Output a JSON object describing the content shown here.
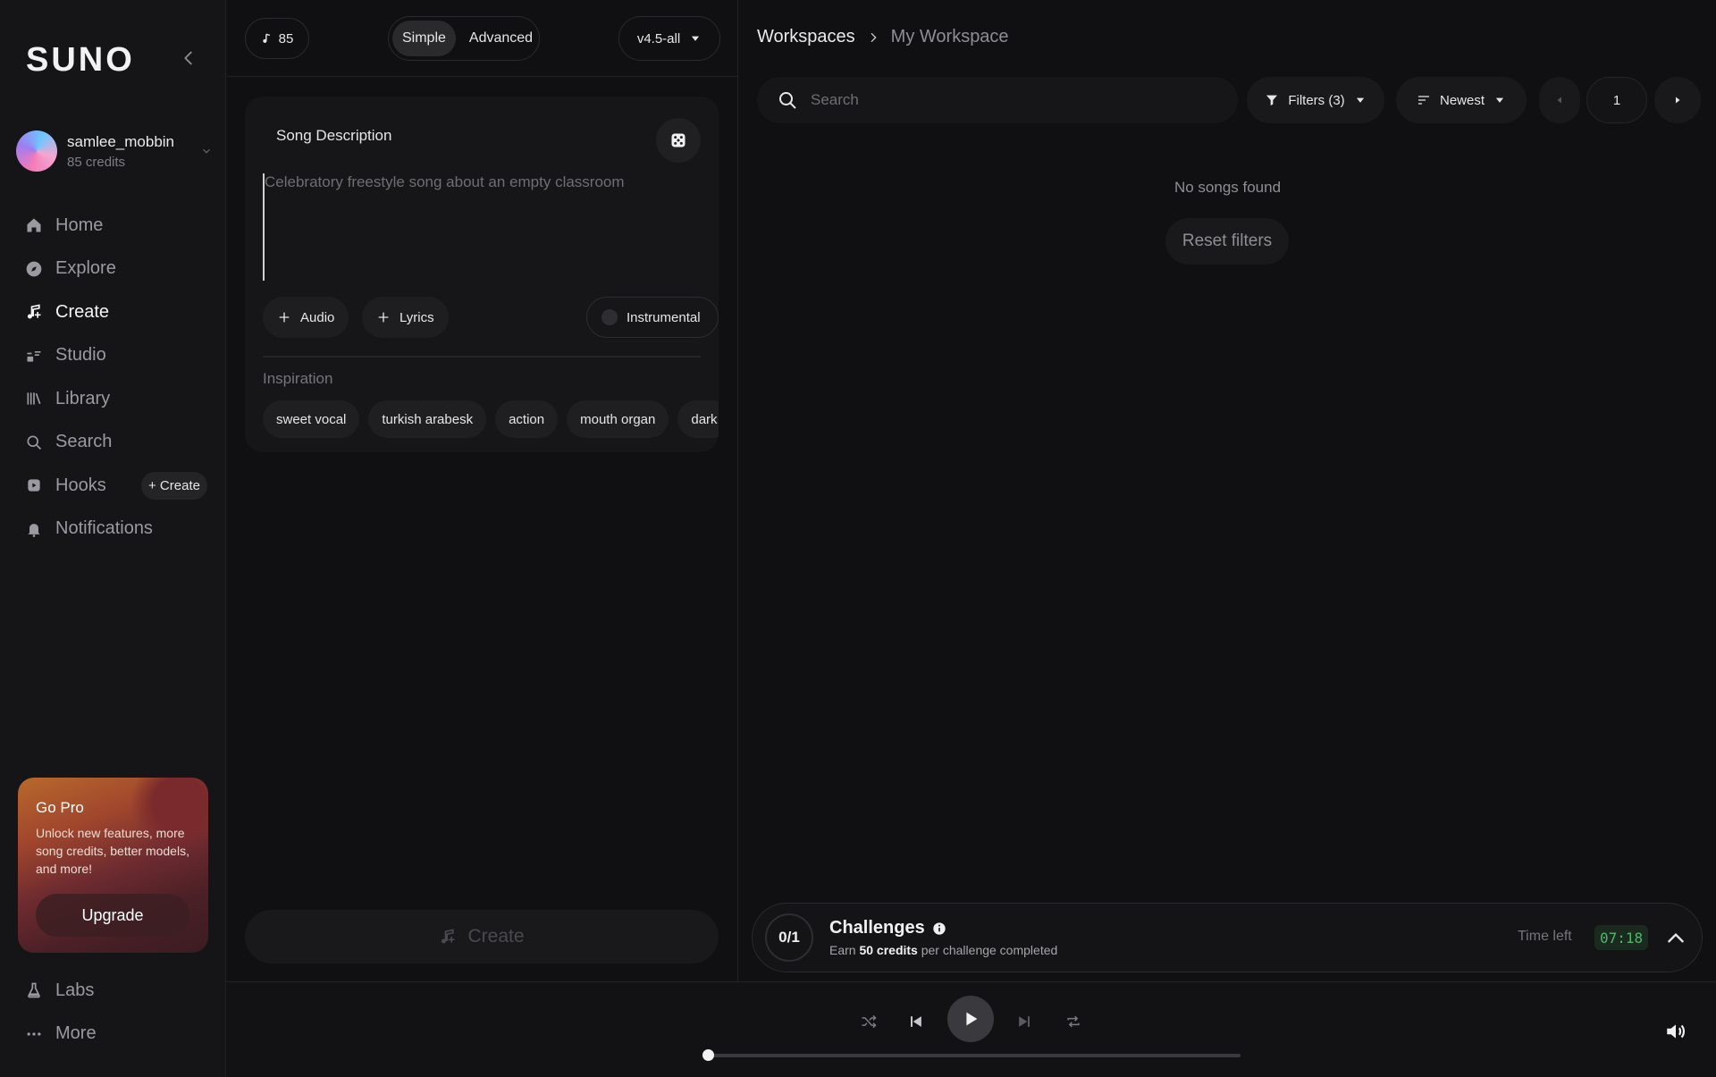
{
  "app": {
    "logo": "SUNO"
  },
  "user": {
    "name": "samlee_mobbin",
    "credits": "85 credits"
  },
  "nav": {
    "items": [
      {
        "label": "Home",
        "icon": "home-icon",
        "active": false
      },
      {
        "label": "Explore",
        "icon": "compass-icon",
        "active": false
      },
      {
        "label": "Create",
        "icon": "music-plus-icon",
        "active": true
      },
      {
        "label": "Studio",
        "icon": "studio-icon",
        "active": false
      },
      {
        "label": "Library",
        "icon": "library-icon",
        "active": false
      },
      {
        "label": "Search",
        "icon": "search-icon",
        "active": false
      },
      {
        "label": "Hooks",
        "icon": "hooks-icon",
        "active": false
      },
      {
        "label": "Notifications",
        "icon": "bell-icon",
        "active": false
      }
    ],
    "hooks_create": "+ Create",
    "bottom": [
      {
        "label": "Labs",
        "icon": "flask-icon"
      },
      {
        "label": "More",
        "icon": "ellipsis-icon"
      }
    ]
  },
  "gopro": {
    "title": "Go Pro",
    "description": "Unlock new features, more song credits, better models, and more!",
    "button": "Upgrade"
  },
  "create_panel": {
    "credits": "85",
    "modes": [
      "Simple",
      "Advanced"
    ],
    "active_mode": "Simple",
    "model": "v4.5-all",
    "description_label": "Song Description",
    "description_value": "",
    "description_placeholder": "Celebratory freestyle song about an empty classroom",
    "audio_btn": "Audio",
    "lyrics_btn": "Lyrics",
    "instrumental_btn": "Instrumental",
    "inspiration_label": "Inspiration",
    "inspiration_tags": [
      "sweet vocal",
      "turkish arabesk",
      "action",
      "mouth organ",
      "dark"
    ],
    "create_btn": "Create"
  },
  "workspace": {
    "breadcrumb": [
      "Workspaces",
      "My Workspace"
    ],
    "search_placeholder": "Search",
    "filters_label": "Filters (3)",
    "sort_label": "Newest",
    "page": "1",
    "empty_text": "No songs found",
    "reset_label": "Reset filters"
  },
  "challenges": {
    "count": "0/1",
    "title": "Challenges",
    "sub_prefix": "Earn",
    "sub_bold": "50 credits",
    "sub_suffix": "per challenge completed",
    "time_label": "Time left",
    "time_value": "07:18"
  },
  "player": {
    "progress": 0.0
  },
  "colors": {
    "accent_green": "#4fb56b",
    "background": "#101012"
  }
}
